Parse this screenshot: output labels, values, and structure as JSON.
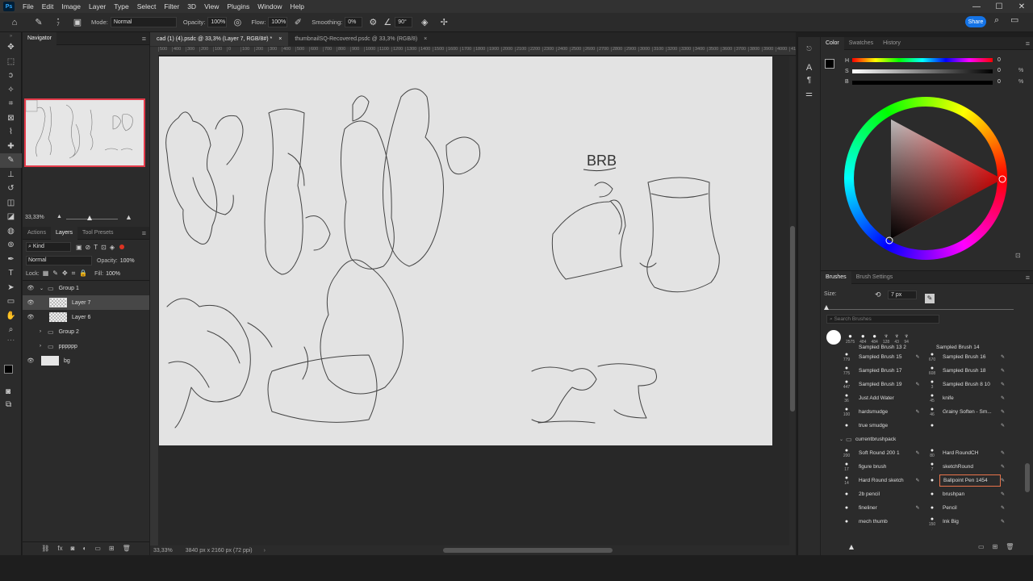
{
  "menu": [
    "File",
    "Edit",
    "Image",
    "Layer",
    "Type",
    "Select",
    "Filter",
    "3D",
    "View",
    "Plugins",
    "Window",
    "Help"
  ],
  "options": {
    "brush_size": "7",
    "mode_label": "Mode:",
    "mode_value": "Normal",
    "opacity_label": "Opacity:",
    "opacity_value": "100%",
    "flow_label": "Flow:",
    "flow_value": "100%",
    "smoothing_label": "Smoothing:",
    "smoothing_value": "0%",
    "angle_value": "90°",
    "share_label": "Share"
  },
  "tabs": [
    {
      "label": "cad (1) (4).psdc @ 33,3% (Layer 7, RGB/8#) *"
    },
    {
      "label": "thumbnailSQ-Recovered.psdc @ 33,3% (RGB/8)"
    }
  ],
  "ruler_ticks": [
    "500",
    "400",
    "300",
    "200",
    "100",
    "0",
    "100",
    "200",
    "300",
    "400",
    "500",
    "600",
    "700",
    "800",
    "900",
    "1000",
    "1100",
    "1200",
    "1300",
    "1400",
    "1500",
    "1600",
    "1700",
    "1800",
    "1900",
    "2000",
    "2100",
    "2200",
    "2300",
    "2400",
    "2500",
    "2600",
    "2700",
    "2800",
    "2900",
    "3000",
    "3100",
    "3200",
    "3300",
    "3400",
    "3500",
    "3600",
    "3700",
    "3800",
    "3900",
    "4000",
    "4100"
  ],
  "navigator": {
    "title": "Navigator",
    "zoom": "33,33%"
  },
  "layers_panel": {
    "tabs": [
      "Actions",
      "Layers",
      "Tool Presets"
    ],
    "kind_label": "Kind",
    "blend_mode": "Normal",
    "opacity_label": "Opacity:",
    "opacity_value": "100%",
    "lock_label": "Lock:",
    "fill_label": "Fill:",
    "fill_value": "100%",
    "layers": [
      {
        "name": "Group 1"
      },
      {
        "name": "Layer 7"
      },
      {
        "name": "Layer 6"
      },
      {
        "name": "Group 2"
      },
      {
        "name": "pppppp"
      },
      {
        "name": "bg"
      }
    ]
  },
  "status": {
    "zoom": "33,33%",
    "doc_info": "3840 px x 2160 px (72 ppi)"
  },
  "color_panel": {
    "tabs": [
      "Color",
      "Swatches",
      "History"
    ],
    "h_label": "H",
    "h_value": "0",
    "s_label": "S",
    "s_value": "0",
    "s_unit": "%",
    "b_label": "B",
    "b_value": "0",
    "b_unit": "%"
  },
  "brushes_panel": {
    "tabs": [
      "Brushes",
      "Brush Settings"
    ],
    "size_label": "Size:",
    "size_value": "7 px",
    "search_placeholder": "Search Brushes",
    "preset_sizes": [
      "2575",
      "484",
      "484",
      "128",
      "43",
      "94"
    ],
    "group_name": "currentbrushpack",
    "sampled_rows": [
      {
        "ln": "779",
        "left": "Sampled Brush 15",
        "rn": "670",
        "right": "Sampled Brush 16"
      },
      {
        "ln": "775",
        "left": "Sampled Brush 17",
        "rn": "608",
        "right": "Sampled Brush 18"
      },
      {
        "ln": "447",
        "left": "Sampled Brush 19",
        "rn": "3",
        "right": "Sampled Brush 8 10"
      },
      {
        "ln": "36",
        "left": "Just Add Water",
        "rn": "45",
        "right": "knife"
      },
      {
        "ln": "100",
        "left": "hardsmudge",
        "rn": "46",
        "right": "Grainy Soften - Sm..."
      },
      {
        "ln": "",
        "left": "true smudge",
        "rn": "",
        "right": ""
      }
    ],
    "pack_rows": [
      {
        "ln": "200",
        "left": "Soft Round 200 1",
        "rn": "80",
        "right": "Hard RoundCH"
      },
      {
        "ln": "17",
        "left": "figure brush",
        "rn": "7",
        "right": "sketchRound"
      },
      {
        "ln": "14",
        "left": "Hard Round sketch",
        "rn": "",
        "right": "Ballpoint Pen 1454"
      },
      {
        "ln": "",
        "left": "2b pencil",
        "rn": "",
        "right": "brushpan"
      },
      {
        "ln": "",
        "left": "fineliner",
        "rn": "",
        "right": "Pencil"
      },
      {
        "ln": "",
        "left": "mech thumb",
        "rn": "150",
        "right": "Ink Big"
      }
    ],
    "top_partial_left": "Sampled Brush 13 2",
    "top_partial_right": "Sampled Brush 14"
  },
  "canvas_text": {
    "brb": "BRB"
  },
  "colors": {
    "accent": "#1473e6",
    "selection": "#e8734a",
    "nav_frame": "#e43b4a"
  }
}
